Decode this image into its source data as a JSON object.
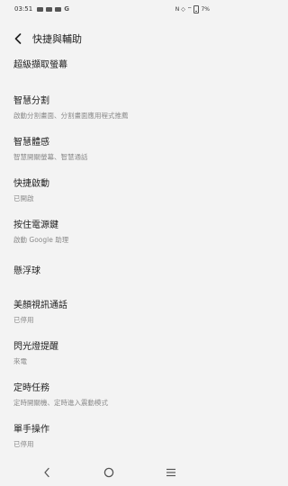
{
  "status_bar": {
    "time": "03:51",
    "battery": "7%"
  },
  "header": {
    "title": "快捷與輔助"
  },
  "items": [
    {
      "title": "超級擷取螢幕",
      "subtitle": ""
    },
    {
      "title": "智慧分割",
      "subtitle": "啟動分割畫面、分割畫面應用程式推薦"
    },
    {
      "title": "智慧體感",
      "subtitle": "智慧開關螢幕、智慧通話"
    },
    {
      "title": "快捷啟動",
      "subtitle": "已開啟"
    },
    {
      "title": "按住電源鍵",
      "subtitle": "啟動 Google 助理"
    },
    {
      "title": "懸浮球",
      "subtitle": ""
    },
    {
      "title": "美顏視訊通話",
      "subtitle": "已停用"
    },
    {
      "title": "閃光燈提醒",
      "subtitle": "來電"
    },
    {
      "title": "定時任務",
      "subtitle": "定時開關機、定時進入震動模式"
    },
    {
      "title": "單手操作",
      "subtitle": "已停用"
    }
  ],
  "nav": {
    "back": "back-icon",
    "home": "home-icon",
    "menu": "menu-icon"
  }
}
